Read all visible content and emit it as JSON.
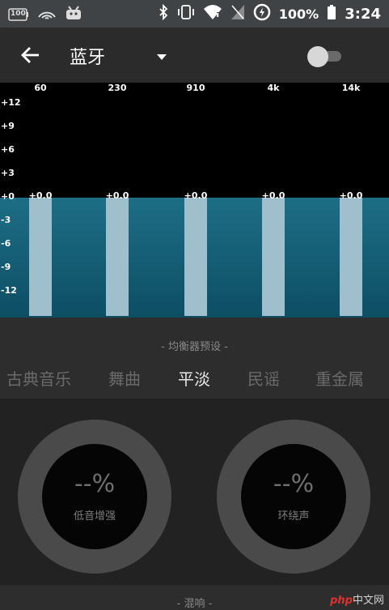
{
  "status_bar": {
    "left_icons": [
      "battery-100-badge-icon",
      "wifi-arc-icon",
      "android-icon"
    ],
    "battery_badge": "100",
    "right_icons": [
      "bluetooth-icon",
      "vibrate-icon",
      "wifi-icon",
      "no-sim-icon",
      "data-saver-icon"
    ],
    "battery_percent": "100%",
    "time": "3:24"
  },
  "toolbar": {
    "title": "蓝牙",
    "back_icon": "arrow-back-icon",
    "dropdown_icon": "dropdown-caret-icon",
    "toggle_on": false
  },
  "equalizer": {
    "frequencies": [
      "60",
      "230",
      "910",
      "4k",
      "14k"
    ],
    "db_labels": [
      "+12",
      "+9",
      "+6",
      "+3",
      "+0",
      "-3",
      "-6",
      "-9",
      "-12"
    ],
    "band_values": [
      "+0.0",
      "+0.0",
      "+0.0",
      "+0.0",
      "+0.0"
    ],
    "colors": {
      "top": "#000000",
      "fill": "#1d6e86",
      "bar": "#9fbfcd"
    }
  },
  "presets": {
    "caption": "- 均衡器预设 -",
    "items": [
      "古典音乐",
      "舞曲",
      "平淡",
      "民谣",
      "重金属"
    ],
    "selected_index": 2
  },
  "effects": {
    "bass": {
      "value": "--%",
      "label": "低音增强"
    },
    "surround": {
      "value": "--%",
      "label": "环绕声"
    }
  },
  "footer": {
    "caption": "- 混响 -",
    "watermark_brand": "php",
    "watermark_site": "中文网"
  }
}
